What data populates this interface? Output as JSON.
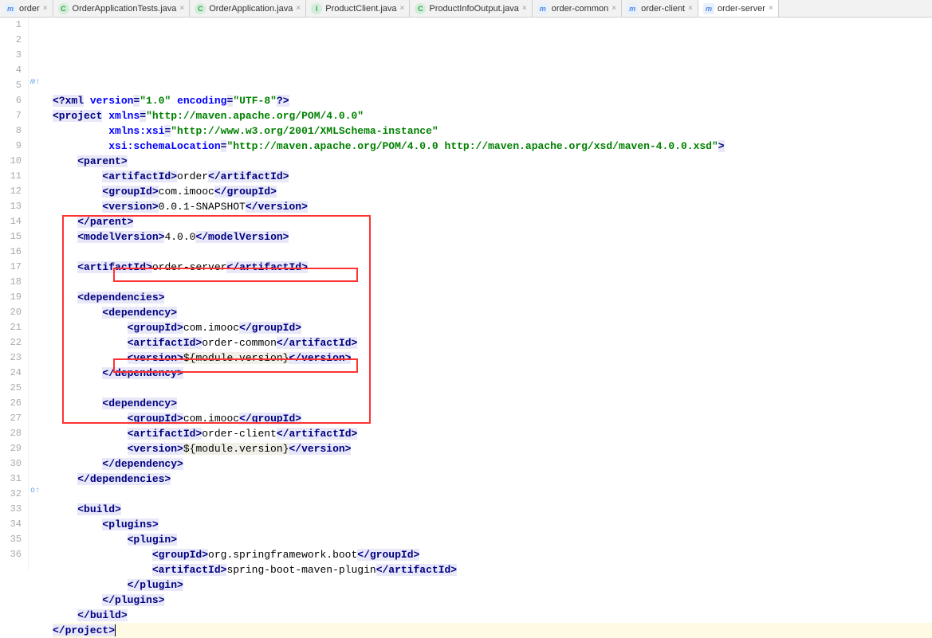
{
  "tabs": [
    {
      "icon": "m",
      "label": "order"
    },
    {
      "icon": "c",
      "label": "OrderApplicationTests.java"
    },
    {
      "icon": "c",
      "label": "OrderApplication.java"
    },
    {
      "icon": "i",
      "label": "ProductClient.java"
    },
    {
      "icon": "c",
      "label": "ProductInfoOutput.java"
    },
    {
      "icon": "m",
      "label": "order-common"
    },
    {
      "icon": "m",
      "label": "order-client"
    },
    {
      "icon": "m",
      "label": "order-server",
      "active": true
    }
  ],
  "line_numbers": [
    "1",
    "2",
    "3",
    "4",
    "5",
    "6",
    "7",
    "8",
    "9",
    "10",
    "11",
    "12",
    "13",
    "14",
    "15",
    "16",
    "17",
    "18",
    "19",
    "20",
    "21",
    "22",
    "23",
    "24",
    "25",
    "26",
    "27",
    "28",
    "29",
    "30",
    "31",
    "32",
    "33",
    "34",
    "35",
    "36"
  ],
  "xml": {
    "decl_version": "1.0",
    "decl_enc": "UTF-8",
    "xmlns": "http://maven.apache.org/POM/4.0.0",
    "xmlns_xsi": "http://www.w3.org/2001/XMLSchema-instance",
    "schema_loc": "http://maven.apache.org/POM/4.0.0 http://maven.apache.org/xsd/maven-4.0.0.xsd",
    "parent_artifact": "order",
    "parent_group": "com.imooc",
    "parent_version": "0.0.1-SNAPSHOT",
    "model_version": "4.0.0",
    "artifact": "order-server",
    "dep1_group": "com.imooc",
    "dep1_artifact": "order-common",
    "dep1_version": "${module.version}",
    "dep2_group": "com.imooc",
    "dep2_artifact": "order-client",
    "dep2_version": "${module.version}",
    "plugin_group": "org.springframework.boot",
    "plugin_artifact": "spring-boot-maven-plugin"
  }
}
